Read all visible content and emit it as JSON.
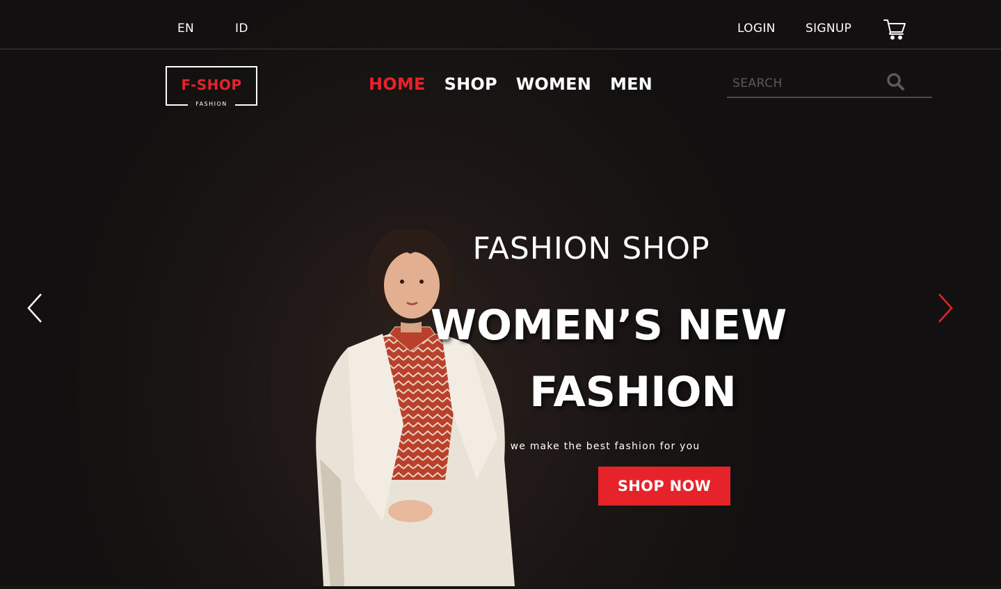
{
  "topbar": {
    "languages": [
      "EN",
      "ID"
    ],
    "login_label": "LOGIN",
    "signup_label": "SIGNUP",
    "cart_icon": "cart-icon"
  },
  "logo": {
    "name": "F-SHOP",
    "tagline": "FASHION"
  },
  "nav": {
    "items": [
      {
        "label": "HOME",
        "active": true
      },
      {
        "label": "SHOP",
        "active": false
      },
      {
        "label": "WOMEN",
        "active": false
      },
      {
        "label": "MEN",
        "active": false
      }
    ]
  },
  "search": {
    "placeholder": "SEARCH",
    "value": "",
    "icon": "search-icon"
  },
  "hero": {
    "title": "FASHION SHOP",
    "headline_line1": "WOMEN’S NEW",
    "headline_line2": "FASHION",
    "subtitle": "we make the best fashion for you",
    "cta_label": "SHOP NOW",
    "prev_icon": "chevron-left-icon",
    "next_icon": "chevron-right-icon"
  },
  "colors": {
    "accent": "#e6222a",
    "background": "#181414",
    "text": "#ffffff"
  }
}
